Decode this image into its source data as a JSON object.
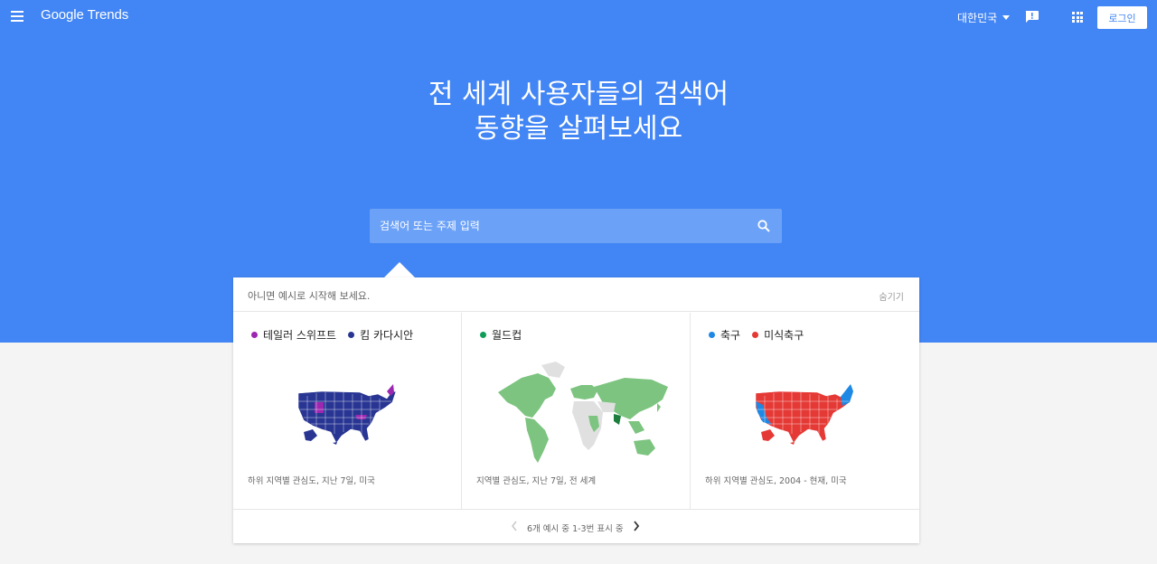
{
  "header": {
    "logo": "Google Trends",
    "region": "대한민국",
    "login_label": "로그인"
  },
  "hero": {
    "headline": "전 세계 사용자들의 검색어 동향을 살펴보세요",
    "search_placeholder": "검색어 또는 주제 입력"
  },
  "examples_panel": {
    "prompt": "아니면 예시로 시작해 보세요.",
    "hide_label": "숨기기",
    "pager_text": "6개 예시 중 1-3번 표시 중",
    "items": [
      {
        "terms": [
          {
            "label": "테일러 스위프트",
            "color": "#9c27b0"
          },
          {
            "label": "킴 카다시안",
            "color": "#283593"
          }
        ],
        "caption": "하위 지역별 관심도, 지난 7일, 미국"
      },
      {
        "terms": [
          {
            "label": "월드컵",
            "color": "#0f9d58"
          }
        ],
        "caption": "지역별 관심도, 지난 7일, 전 세계"
      },
      {
        "terms": [
          {
            "label": "축구",
            "color": "#1e88e5"
          },
          {
            "label": "미식축구",
            "color": "#e53935"
          }
        ],
        "caption": "하위 지역별 관심도, 2004 - 현재, 미국"
      }
    ]
  },
  "colors": {
    "brand_blue": "#4285f4",
    "search_bg": "#6ba1f7",
    "world_cup_light": "#7cc47f",
    "world_cup_dark": "#1b7e3c",
    "no_data": "#e0e0e0"
  }
}
